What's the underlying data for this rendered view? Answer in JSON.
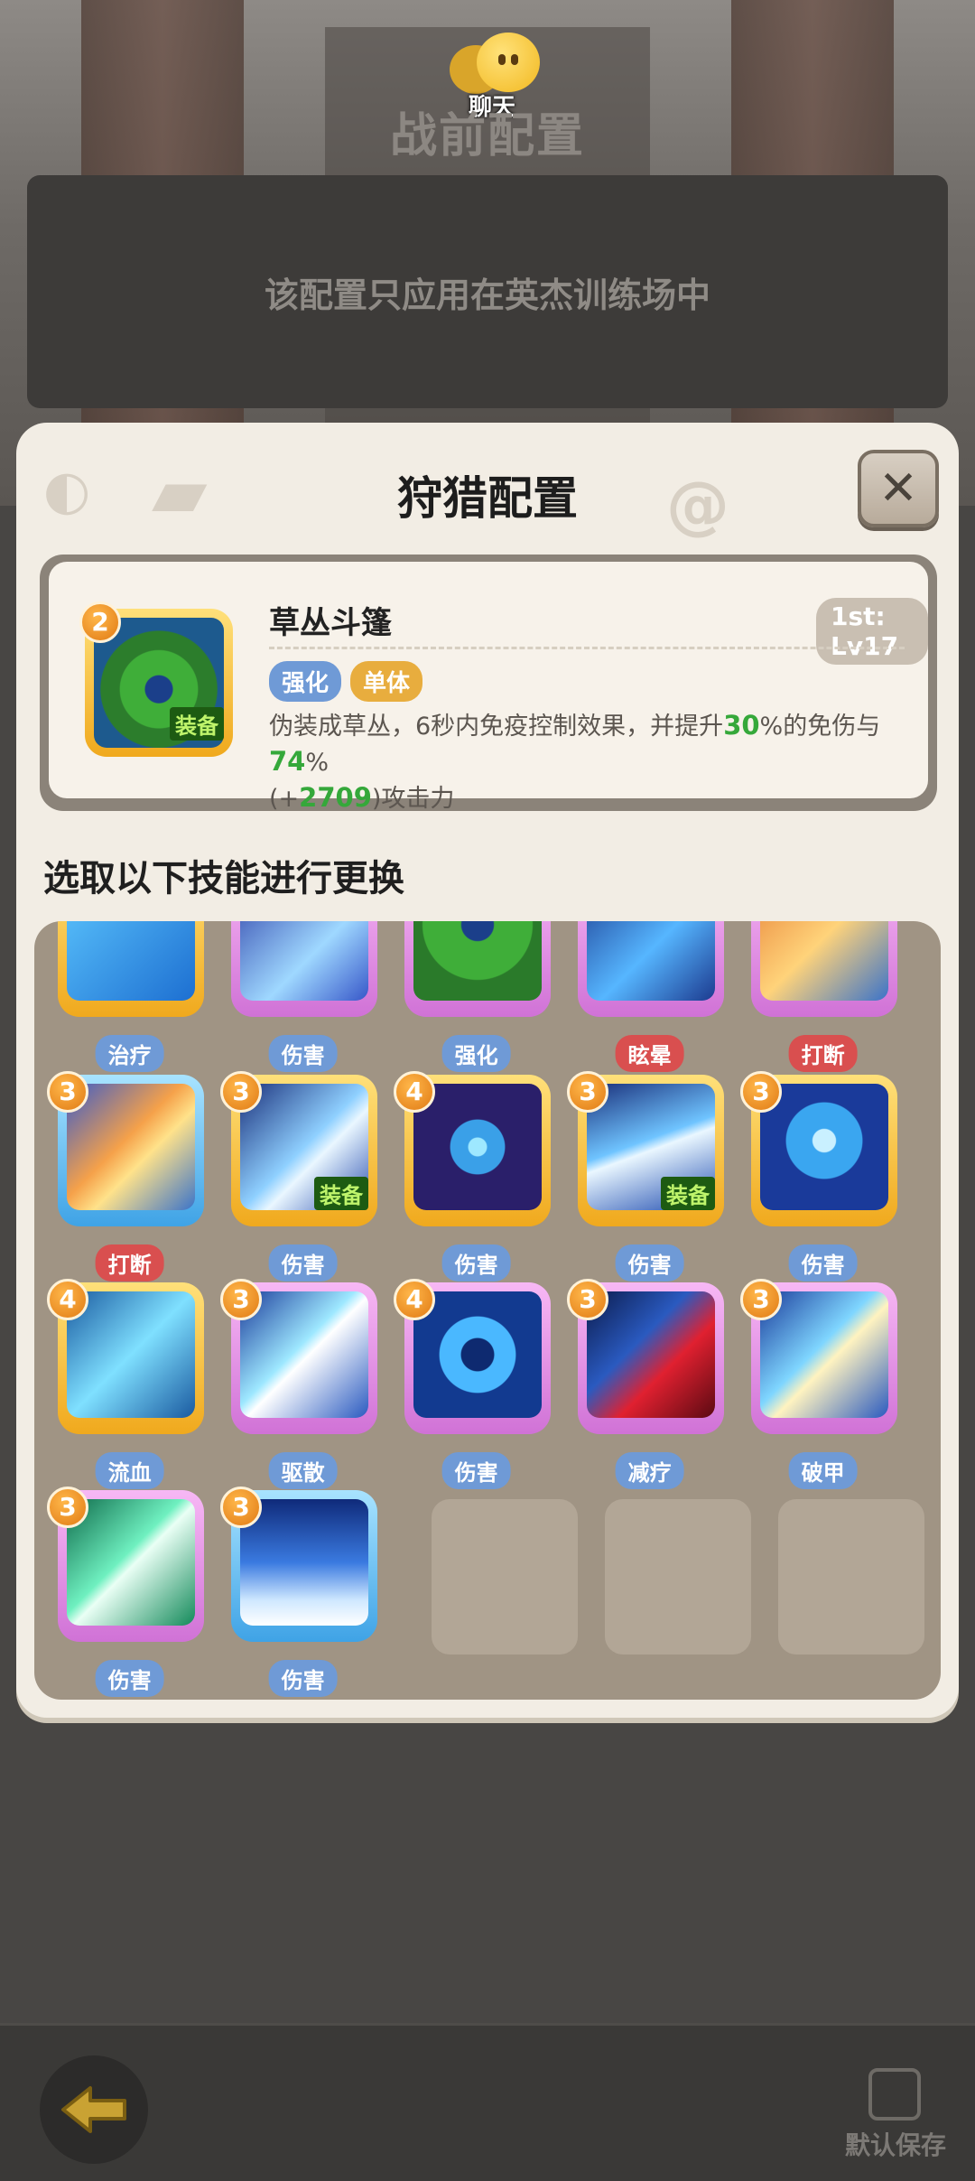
{
  "header": {
    "chat_label": "聊天",
    "page_title": "战前配置",
    "notice": "该配置只应用在英杰训练场中"
  },
  "panel": {
    "title": "狩猎配置",
    "close": "✕"
  },
  "selected": {
    "level": "2",
    "name": "草丛斗篷",
    "lv_badge": "1st: Lv17",
    "equip": "装备",
    "tags": [
      "强化",
      "单体"
    ],
    "desc_part1": "伪装成草丛，6秒内免疫控制效果，并提升",
    "val1": "30",
    "desc_part2": "%的免伤与",
    "val2": "74",
    "desc_part3": "%",
    "desc_part4": "(+",
    "val3": "2709",
    "desc_part5": ")攻击力"
  },
  "section_title": "选取以下技能进行更换",
  "row1": [
    {
      "cat": "治疗",
      "cat_color": "blue",
      "frame": "gold",
      "art": "heal"
    },
    {
      "cat": "伤害",
      "cat_color": "blue",
      "frame": "purple",
      "art": "ice"
    },
    {
      "cat": "强化",
      "cat_color": "blue",
      "frame": "purple",
      "art": "bush"
    },
    {
      "cat": "眩晕",
      "cat_color": "red",
      "frame": "purple",
      "art": "stun"
    },
    {
      "cat": "打断",
      "cat_color": "red",
      "frame": "purple",
      "art": "fist"
    }
  ],
  "row2": [
    {
      "level": "3",
      "cat": "打断",
      "cat_color": "red",
      "frame": "blue",
      "art": "fist",
      "equip": ""
    },
    {
      "level": "3",
      "cat": "伤害",
      "cat_color": "blue",
      "frame": "gold",
      "art": "daggers",
      "equip": "装备"
    },
    {
      "level": "4",
      "cat": "伤害",
      "cat_color": "blue",
      "frame": "gold",
      "art": "swirl",
      "equip": ""
    },
    {
      "level": "3",
      "cat": "伤害",
      "cat_color": "blue",
      "frame": "gold",
      "art": "spears",
      "equip": "装备"
    },
    {
      "level": "3",
      "cat": "伤害",
      "cat_color": "blue",
      "frame": "gold",
      "art": "ghost",
      "equip": ""
    }
  ],
  "row3": [
    {
      "level": "4",
      "cat": "流血",
      "cat_color": "blue",
      "frame": "gold",
      "art": "kunai"
    },
    {
      "level": "3",
      "cat": "驱散",
      "cat_color": "blue",
      "frame": "purple",
      "art": "bone"
    },
    {
      "level": "4",
      "cat": "伤害",
      "cat_color": "blue",
      "frame": "purple",
      "art": "vortex"
    },
    {
      "level": "3",
      "cat": "减疗",
      "cat_color": "blue",
      "frame": "purple",
      "art": "red"
    },
    {
      "level": "3",
      "cat": "破甲",
      "cat_color": "blue",
      "frame": "purple",
      "art": "horn"
    }
  ],
  "row4": [
    {
      "level": "3",
      "cat": "伤害",
      "cat_color": "blue",
      "frame": "purple",
      "art": "green"
    },
    {
      "level": "3",
      "cat": "伤害",
      "cat_color": "blue",
      "frame": "blue",
      "art": "spikes"
    }
  ],
  "footer": {
    "save_label": "默认保存"
  }
}
